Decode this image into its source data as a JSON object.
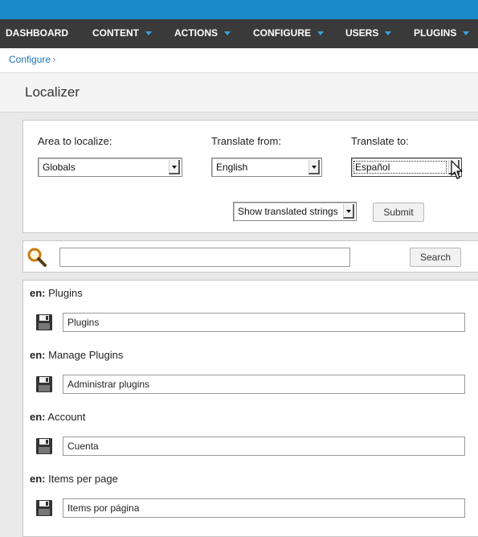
{
  "nav": {
    "items": [
      {
        "label": "DASHBOARD",
        "has_dropdown": false
      },
      {
        "label": "CONTENT",
        "has_dropdown": true
      },
      {
        "label": "ACTIONS",
        "has_dropdown": true
      },
      {
        "label": "CONFIGURE",
        "has_dropdown": true
      },
      {
        "label": "USERS",
        "has_dropdown": true
      },
      {
        "label": "PLUGINS",
        "has_dropdown": true
      }
    ]
  },
  "breadcrumb": {
    "items": [
      "Configure"
    ],
    "separator": "›"
  },
  "page": {
    "title": "Localizer"
  },
  "filters": {
    "area_label": "Area to localize:",
    "area_value": "Globals",
    "from_label": "Translate from:",
    "from_value": "English",
    "to_label": "Translate to:",
    "to_value": "Español",
    "show_value": "Show translated strings",
    "submit_label": "Submit"
  },
  "search": {
    "value": "",
    "button_label": "Search"
  },
  "strings": {
    "prefix": "en:",
    "items": [
      {
        "source": "Plugins",
        "translation": "Plugins"
      },
      {
        "source": "Manage Plugins",
        "translation": "Administrar plugins"
      },
      {
        "source": "Account",
        "translation": "Cuenta"
      },
      {
        "source": "Items per page",
        "translation": "Items por página"
      }
    ]
  },
  "icons": {
    "search": "magnifier-icon",
    "save": "floppy-disk-icon",
    "cursor": "mouse-pointer-icon"
  },
  "colors": {
    "topbar": "#1b8ac8",
    "navbar": "#3a3a3a",
    "nav_caret": "#36a3e0",
    "link": "#1b72b8"
  }
}
